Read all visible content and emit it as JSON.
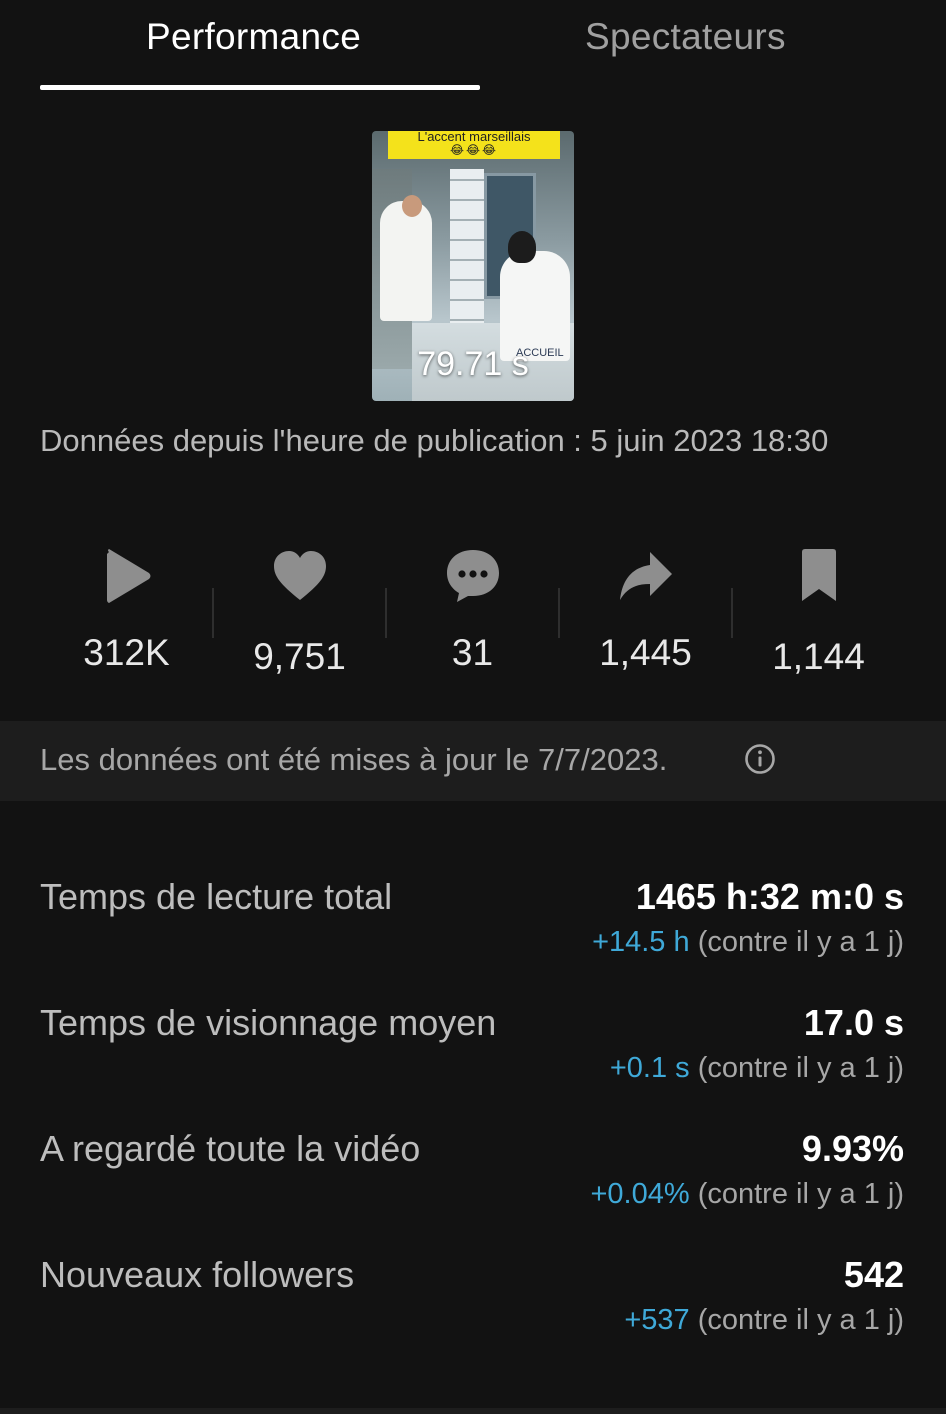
{
  "tabs": [
    {
      "label": "Performance",
      "active": true
    },
    {
      "label": "Spectateurs",
      "active": false
    }
  ],
  "video": {
    "thumbnail_caption": "L'accent marseillais",
    "thumbnail_emojis": "😂😂😂",
    "thumbnail_sign": "ACCUEIL",
    "duration": "79.71 s"
  },
  "published": {
    "text": "Données depuis l'heure de publication : 5 juin 2023 18:30"
  },
  "stats": [
    {
      "icon": "play-icon",
      "value": "312K"
    },
    {
      "icon": "heart-icon",
      "value": "9,751"
    },
    {
      "icon": "comment-icon",
      "value": "31"
    },
    {
      "icon": "share-icon",
      "value": "1,445"
    },
    {
      "icon": "bookmark-icon",
      "value": "1,144"
    }
  ],
  "update": {
    "text": "Les données ont été mises à jour le 7/7/2023."
  },
  "metrics": [
    {
      "label": "Temps de lecture total",
      "value": "1465 h:32 m:0 s",
      "delta": "+14.5 h",
      "compare": "(contre il y a 1 j)"
    },
    {
      "label": "Temps de visionnage moyen",
      "value": "17.0 s",
      "delta": "+0.1 s",
      "compare": "(contre il y a 1 j)"
    },
    {
      "label": "A regardé toute la vidéo",
      "value": "9.93%",
      "delta": "+0.04%",
      "compare": "(contre il y a 1 j)"
    },
    {
      "label": "Nouveaux followers",
      "value": "542",
      "delta": "+537",
      "compare": "(contre il y a 1 j)"
    }
  ],
  "colors": {
    "background": "#121212",
    "band": "#1d1d1d",
    "positive_delta": "#3fa9d8",
    "icon_gray": "#8e8e8e"
  }
}
